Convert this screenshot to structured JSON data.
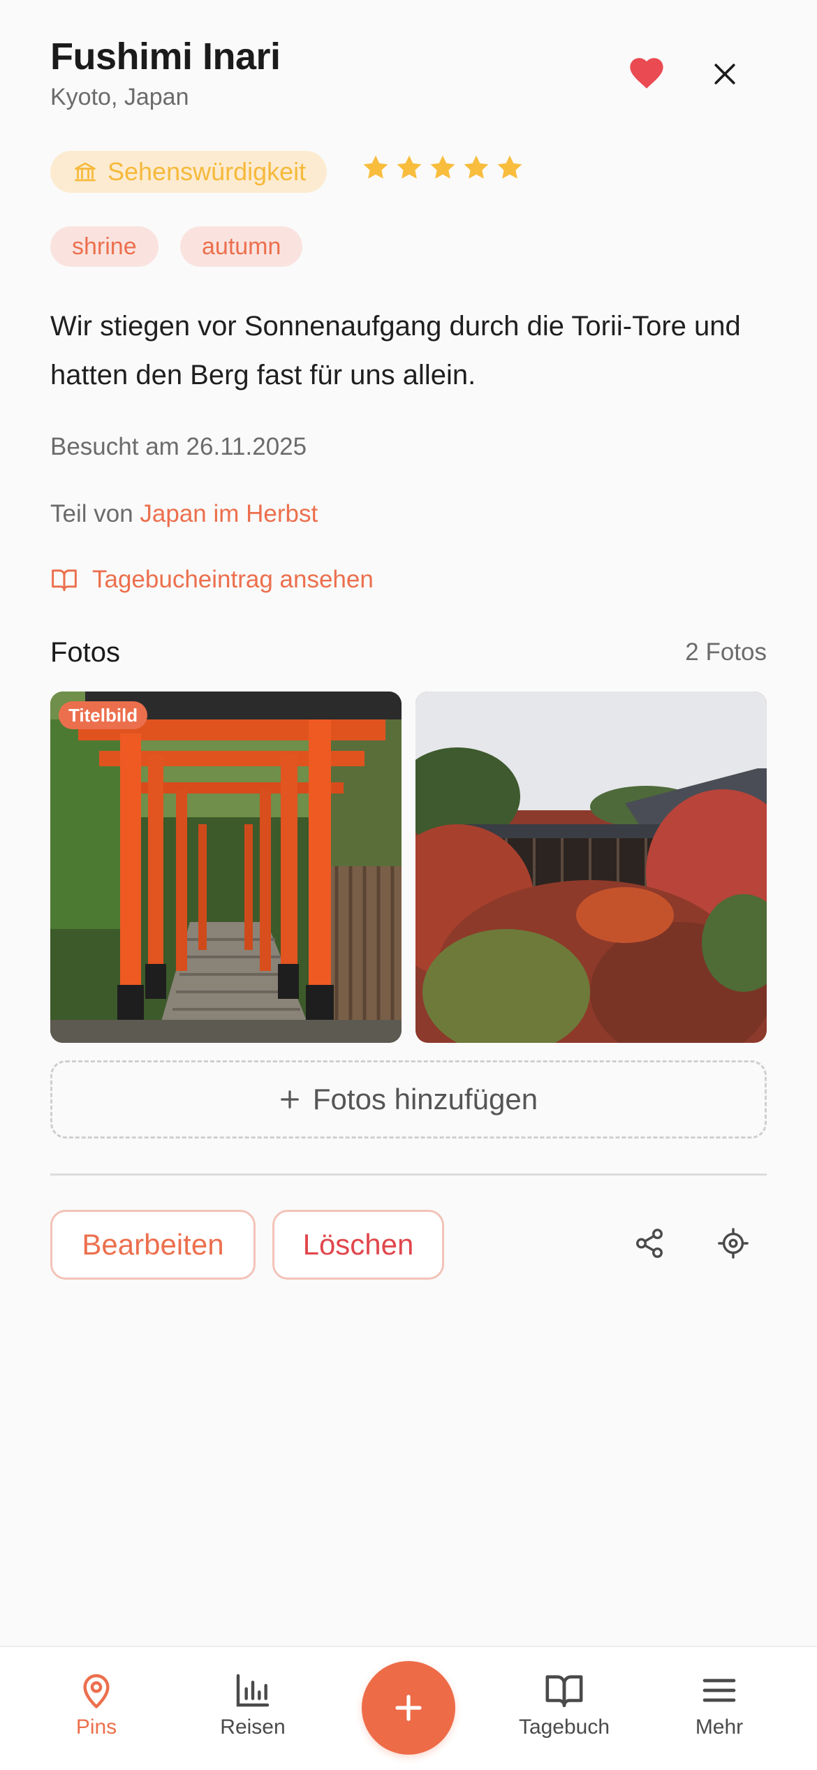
{
  "place": {
    "title": "Fushimi Inari",
    "location": "Kyoto, Japan",
    "category": "Sehenswürdigkeit",
    "rating": 5,
    "tags": [
      "shrine",
      "autumn"
    ],
    "description": "Wir stiegen vor Sonnenaufgang durch die Torii-Tore und hatten den Berg fast für uns allein.",
    "visited": "Besucht am 26.11.2025",
    "part_of_prefix": "Teil von",
    "trip_name": "Japan im Herbst",
    "journal_link": "Tagebucheintrag ansehen",
    "favorite": true
  },
  "photos": {
    "heading": "Fotos",
    "count": "2 Fotos",
    "cover_badge": "Titelbild",
    "add_label": "Fotos hinzufügen",
    "items": [
      {
        "subject": "torii-gates-path",
        "is_cover": true
      },
      {
        "subject": "temple-autumn-foliage",
        "is_cover": false
      }
    ]
  },
  "actions": {
    "edit": "Bearbeiten",
    "delete": "Löschen",
    "share_icon": "share-icon",
    "locate_icon": "crosshair-icon"
  },
  "nav": {
    "items": [
      {
        "label": "Pins",
        "icon": "map-pin-icon",
        "active": true
      },
      {
        "label": "Reisen",
        "icon": "bar-chart-icon",
        "active": false
      },
      {
        "label": "Tagebuch",
        "icon": "book-icon",
        "active": false
      },
      {
        "label": "Mehr",
        "icon": "menu-icon",
        "active": false
      }
    ],
    "fab_icon": "plus-icon"
  },
  "colors": {
    "accent": "#ec6f4d",
    "heart": "#ea4a52",
    "star": "#f8bd3d",
    "category_bg": "#fcebd0",
    "category_text": "#f6b93b",
    "tag_bg": "#fae3df",
    "delete_text": "#e0474c"
  }
}
